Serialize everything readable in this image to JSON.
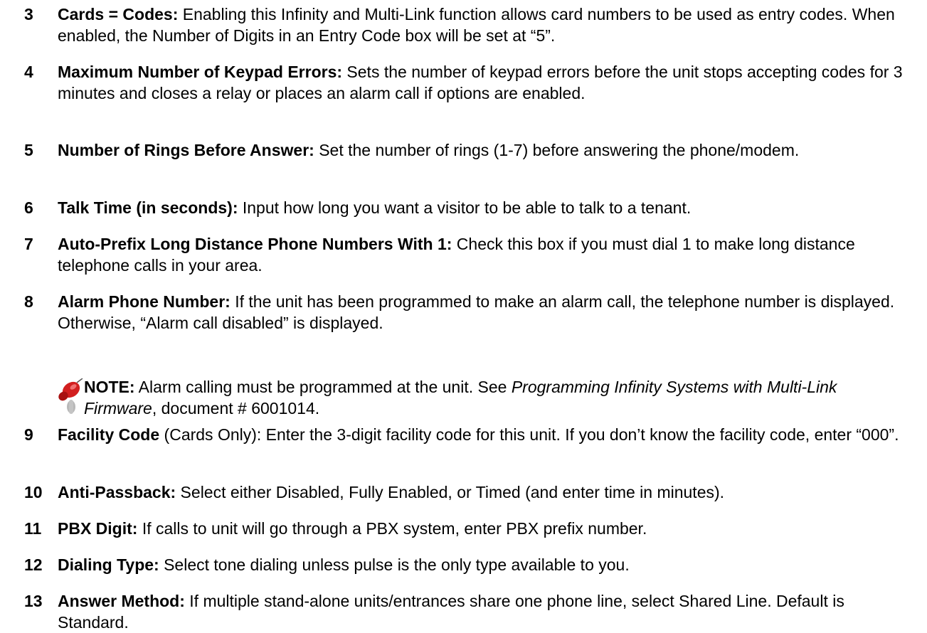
{
  "items": [
    {
      "num": "3",
      "term": "Cards = Codes:",
      "desc": " Enabling this Infinity and Multi-Link function allows card numbers to be used as entry codes.  When enabled, the Number of Digits in an Entry Code box will be set at “5”."
    },
    {
      "num": "4",
      "term": "Maximum Number of Keypad Errors:",
      "desc": " Sets the number of keypad errors before the unit stops accepting codes for 3 minutes and closes a relay or places an alarm call if options are enabled."
    },
    {
      "num": "5",
      "term": "Number of Rings Before Answer:",
      "desc": " Set the number of rings (1-7) before answering the phone/modem."
    },
    {
      "num": "6",
      "term": "Talk Time (in seconds):",
      "desc": " Input how long you want a visitor to be able to talk to a tenant."
    },
    {
      "num": "7",
      "term": "Auto-Prefix Long Distance Phone Numbers With 1:",
      "desc": " Check this box if you must dial 1 to make long distance telephone calls in your area."
    },
    {
      "num": "8",
      "term": "Alarm Phone Number:",
      "desc": " If the unit has been programmed to make an alarm call, the telephone number is displayed.  Otherwise, “Alarm call disabled” is displayed."
    },
    {
      "num": "9",
      "term": "Facility Code",
      "desc": " (Cards Only): Enter the 3-digit facility code for this unit.  If you don’t know the facility code, enter “000”."
    },
    {
      "num": "10",
      "term": "Anti-Passback:",
      "desc": " Select either Disabled, Fully Enabled, or Timed (and enter time in minutes)."
    },
    {
      "num": "11",
      "term": "PBX Digit:",
      "desc": " If calls to unit will go through a PBX system, enter PBX prefix number."
    },
    {
      "num": "12",
      "term": "Dialing Type:",
      "desc": " Select tone dialing unless pulse is the only type available to you."
    },
    {
      "num": "13",
      "term": "Answer Method:",
      "desc": " If multiple stand-alone units/entrances share one phone line, select Shared Line.  Default is Standard."
    }
  ],
  "note": {
    "label": "NOTE:",
    "text_before": " Alarm calling must be programmed at the unit.  See ",
    "doc_title": "Programming Infinity Systems with Multi-Link Firmware",
    "text_after": ", document # 6001014.",
    "icon": "pushpin-icon"
  }
}
